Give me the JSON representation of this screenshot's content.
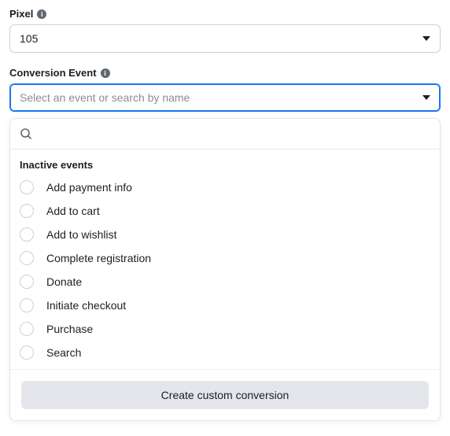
{
  "pixel": {
    "label": "Pixel",
    "value": "105"
  },
  "conversionEvent": {
    "label": "Conversion Event",
    "placeholder": "Select an event or search by name",
    "searchPlaceholder": "",
    "groupHeader": "Inactive events",
    "events": [
      "Add payment info",
      "Add to cart",
      "Add to wishlist",
      "Complete registration",
      "Donate",
      "Initiate checkout",
      "Purchase",
      "Search"
    ],
    "createButton": "Create custom conversion"
  }
}
